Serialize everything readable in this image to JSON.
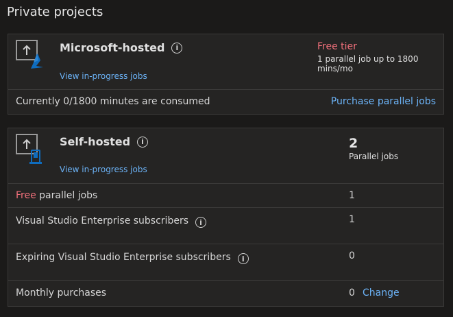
{
  "page_title": "Private projects",
  "microsoft_hosted": {
    "title": "Microsoft-hosted",
    "view_jobs": "View in-progress jobs",
    "tier_label": "Free tier",
    "tier_desc_1": "1 parallel job up to 1800",
    "tier_desc_2": "mins/mo",
    "consumed_text": "Currently 0/1800 minutes are consumed",
    "purchase_link": "Purchase parallel jobs"
  },
  "self_hosted": {
    "title": "Self-hosted",
    "view_jobs": "View in-progress jobs",
    "parallel_count": "2",
    "parallel_label": "Parallel jobs",
    "rows": [
      {
        "label_prefix": "Free",
        "label": " parallel jobs",
        "value": "1"
      },
      {
        "label": "Visual Studio Enterprise subscribers",
        "value": "1",
        "info": true
      },
      {
        "label": "Expiring Visual Studio Enterprise subscribers",
        "value": "0",
        "info": true
      },
      {
        "label": "Monthly purchases",
        "value": "0",
        "action": "Change"
      }
    ]
  },
  "colors": {
    "accent_link": "#6cb3f7",
    "free_red": "#f1707b",
    "azure_blue": "#0078d4"
  }
}
